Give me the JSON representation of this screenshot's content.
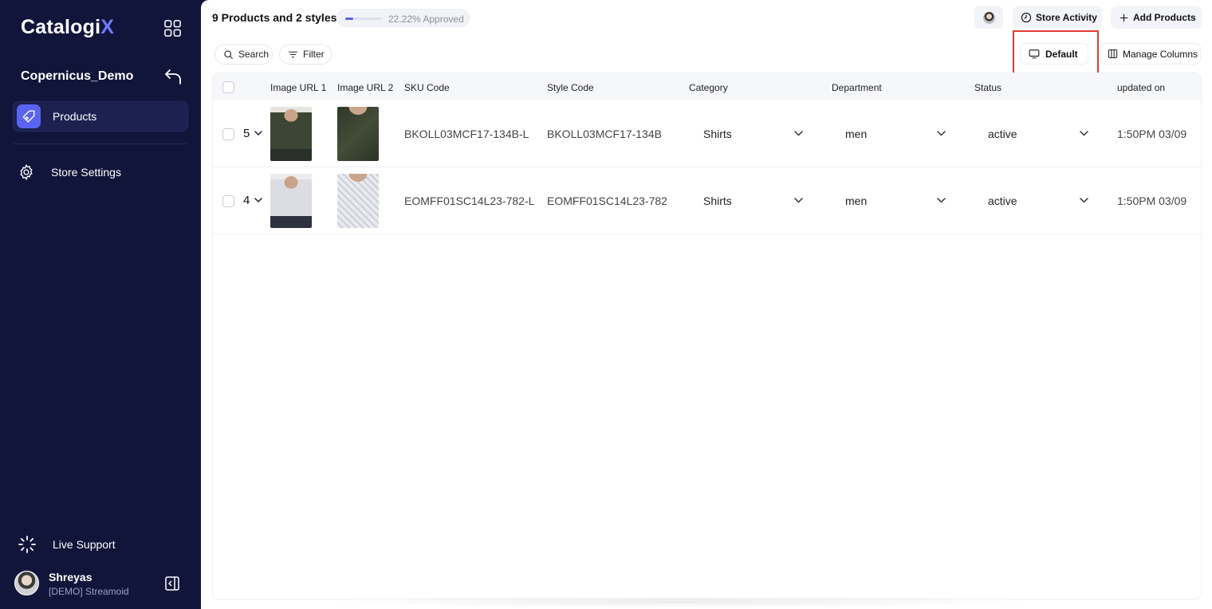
{
  "sidebar": {
    "logo_main": "Catalogi",
    "logo_accent": "X",
    "workspace": "Copernicus_Demo",
    "nav_products": "Products",
    "nav_settings": "Store Settings",
    "live_support": "Live Support",
    "user_name": "Shreyas",
    "user_org": "[DEMO] Streamoid"
  },
  "topbar": {
    "title": "9 Products and 2 styles",
    "progress_text": "22.22% Approved",
    "progress_fraction": 0.2222,
    "store_activity": "Store Activity",
    "add_products": "Add Products"
  },
  "toolbar": {
    "search": "Search",
    "filter": "Filter",
    "default_view": "Default",
    "manage_columns": "Manage Columns"
  },
  "table": {
    "headers": {
      "image1": "Image URL 1",
      "image2": "Image URL 2",
      "sku": "SKU Code",
      "style": "Style Code",
      "category": "Category",
      "department": "Department",
      "status": "Status",
      "updated": "updated on"
    },
    "rows": [
      {
        "count": "5",
        "sku": "BKOLL03MCF17-134B-L",
        "style": "BKOLL03MCF17-134B",
        "category": "Shirts",
        "department": "men",
        "status": "active",
        "updated": "1:50PM 03/09"
      },
      {
        "count": "4",
        "sku": "EOMFF01SC14L23-782-L",
        "style": "EOMFF01SC14L23-782",
        "category": "Shirts",
        "department": "men",
        "status": "active",
        "updated": "1:50PM 03/09"
      }
    ]
  },
  "colors": {
    "sidebar_bg": "#12153a",
    "accent": "#5b64f0",
    "highlight": "#e23b32"
  },
  "icons": [
    "apps-grid-icon",
    "back-arrow-icon",
    "tag-icon",
    "gear-icon",
    "loading-spinner-icon",
    "collapse-sidebar-icon",
    "clock-icon",
    "plus-icon",
    "search-icon",
    "filter-icon",
    "monitor-icon",
    "columns-icon",
    "chevron-down-icon"
  ]
}
